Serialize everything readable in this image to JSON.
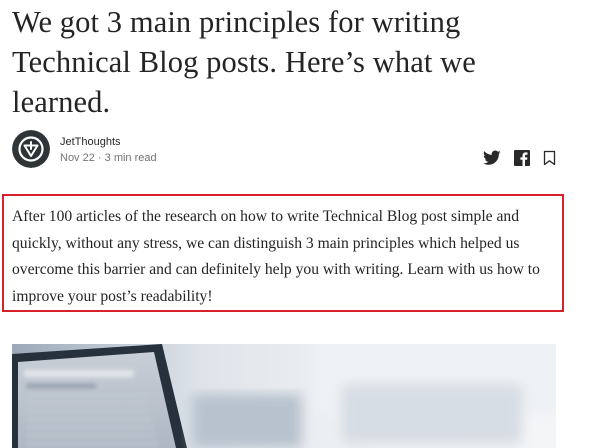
{
  "article": {
    "title": "We got 3 main principles for writing Technical Blog posts. Here’s what we learned.",
    "author": "JetThoughts",
    "date": "Nov 22",
    "separator": "·",
    "read_time": "3 min read",
    "intro": "After 100 articles of the research on how to write Technical Blog post simple and quickly, without any stress, we can distinguish 3 main principles which helped us overcome this barrier and can definitely help you with writing. Learn with us how to improve your post’s readability!"
  },
  "actions": {
    "items": [
      "twitter-icon",
      "facebook-icon",
      "bookmark-icon"
    ]
  },
  "colors": {
    "highlight_border": "#d8202a",
    "text": "#242424",
    "meta": "#757575",
    "avatar_bg": "#2f3437"
  },
  "hero_image": {
    "description_icon": "laptop-photo"
  }
}
